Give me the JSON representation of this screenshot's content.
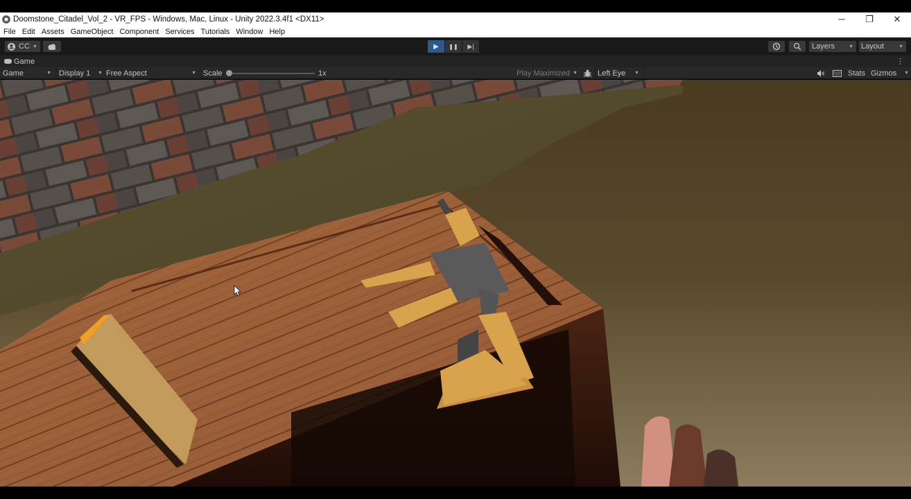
{
  "window": {
    "title": "Doomstone_Citadel_Vol_2 - VR_FPS - Windows, Mac, Linux - Unity 2022.3.4f1 <DX11>",
    "controls": {
      "minimize": "─",
      "restore": "❐",
      "close": "✕"
    }
  },
  "menu": {
    "items": [
      "File",
      "Edit",
      "Assets",
      "GameObject",
      "Component",
      "Services",
      "Tutorials",
      "Window",
      "Help"
    ]
  },
  "toolbar": {
    "account_label": "CC",
    "account_icon": "account-icon",
    "cloud_icon": "cloud-icon",
    "play_icon": "▶",
    "pause_icon": "❚❚",
    "step_icon": "▶|",
    "play_active": true,
    "history_icon": "history-icon",
    "search_icon": "search-icon",
    "layers_label": "Layers",
    "layout_label": "Layout"
  },
  "tab": {
    "label": "Game",
    "menu_icon": "⋮"
  },
  "game_toolbar": {
    "mode": "Game",
    "display": "Display 1",
    "aspect": "Free Aspect",
    "scale_label": "Scale",
    "scale_value": "1x",
    "scale_fraction": 0.0,
    "play_mode": "Play Maximized",
    "eye": "Left Eye",
    "stats_label": "Stats",
    "gizmos_label": "Gizmos"
  },
  "colors": {
    "toolbar_bg": "#191919",
    "panel_bg": "#282828",
    "play_active": "#2b5a8a",
    "brick": "#6b4a3a",
    "crate_wood": "#9a5e36",
    "ground": "#5c4a2b",
    "weapon_tan": "#d9a24c",
    "weapon_metal": "#5a5a5a"
  }
}
